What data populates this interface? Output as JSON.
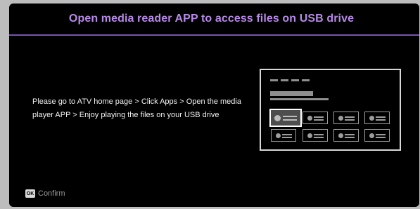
{
  "dialog": {
    "title": "Open media reader APP to access files on USB drive",
    "instructions": "Please go to ATV home page > Click Apps > Open the media player APP > Enjoy playing the files on your USB drive",
    "illustration": {
      "icon": "tv-home-screen-illustration",
      "selected_tile": "apps-tile"
    },
    "footer": {
      "ok_key_label": "OK",
      "confirm_label": "Confirm"
    }
  },
  "colors": {
    "title": "#b78ae6",
    "divider": "#7b51b3",
    "background": "#000000"
  }
}
